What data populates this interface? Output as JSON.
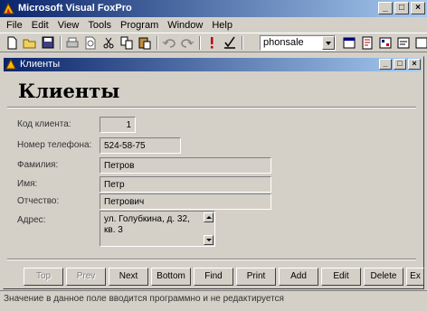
{
  "app": {
    "title": "Microsoft Visual FoxPro",
    "window_buttons": [
      "_",
      "□",
      "×"
    ]
  },
  "menu": [
    "File",
    "Edit",
    "View",
    "Tools",
    "Program",
    "Window",
    "Help"
  ],
  "toolbar": {
    "icons": [
      "new-icon",
      "open-icon",
      "save-icon",
      "print-icon",
      "print-preview-icon",
      "cut-icon",
      "copy-icon",
      "paste-icon",
      "undo-icon",
      "redo-icon",
      "run-icon",
      "modify-icon",
      "form-icon",
      "report-icon",
      "properties-icon",
      "command-icon"
    ],
    "combo_value": "phonsale"
  },
  "child": {
    "title": "Клиенты",
    "window_buttons": [
      "_",
      "□",
      "×"
    ]
  },
  "form": {
    "heading": "Клиенты",
    "fields": {
      "client_code": {
        "label": "Код клиента:",
        "value": "1"
      },
      "phone": {
        "label": "Номер телефона:",
        "value": "524-58-75"
      },
      "surname": {
        "label": "Фамилия:",
        "value": "Петров"
      },
      "name": {
        "label": "Имя:",
        "value": "Петр"
      },
      "patronymic": {
        "label": "Отчество:",
        "value": "Петрович"
      },
      "address": {
        "label": "Адрес:",
        "value": "ул. Голубкина, д. 32, кв. 3"
      }
    }
  },
  "nav_buttons": [
    {
      "label": "Top",
      "enabled": false
    },
    {
      "label": "Prev",
      "enabled": false
    },
    {
      "label": "Next",
      "enabled": true
    },
    {
      "label": "Bottom",
      "enabled": true
    },
    {
      "label": "Find",
      "enabled": true
    },
    {
      "label": "Print",
      "enabled": true
    },
    {
      "label": "Add",
      "enabled": true
    },
    {
      "label": "Edit",
      "enabled": true
    },
    {
      "label": "Delete",
      "enabled": true
    },
    {
      "label": "Ex",
      "enabled": true
    }
  ],
  "status": "Значение в данное поле вводится программно и не редактируется",
  "colors": {
    "titlebar_start": "#0a246a",
    "titlebar_end": "#a6caf0",
    "face": "#d4d0c8"
  }
}
